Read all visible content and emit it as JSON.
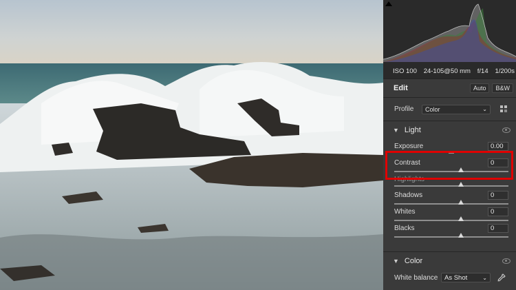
{
  "camera": {
    "iso": "ISO 100",
    "lens": "24-105@50 mm",
    "aperture": "f/14",
    "shutter": "1/200s"
  },
  "edit": {
    "title": "Edit",
    "auto_label": "Auto",
    "bw_label": "B&W"
  },
  "profile": {
    "label": "Profile",
    "value": "Color",
    "grid_icon": "profile-browser-icon"
  },
  "light": {
    "title": "Light",
    "sliders": [
      {
        "label": "Exposure",
        "value": "0.00",
        "position": 0.5
      },
      {
        "label": "Contrast",
        "value": "0",
        "position": 0.5
      },
      {
        "label": "Highlights",
        "value": "0",
        "position": 0.5
      },
      {
        "label": "Shadows",
        "value": "0",
        "position": 0.5
      },
      {
        "label": "Whites",
        "value": "0",
        "position": 0.5
      },
      {
        "label": "Blacks",
        "value": "0",
        "position": 0.5
      }
    ]
  },
  "color": {
    "title": "Color",
    "wb_label": "White balance",
    "wb_value": "As Shot"
  },
  "colors": {
    "highlight": "#e00000",
    "panel": "#3a3a3a"
  }
}
